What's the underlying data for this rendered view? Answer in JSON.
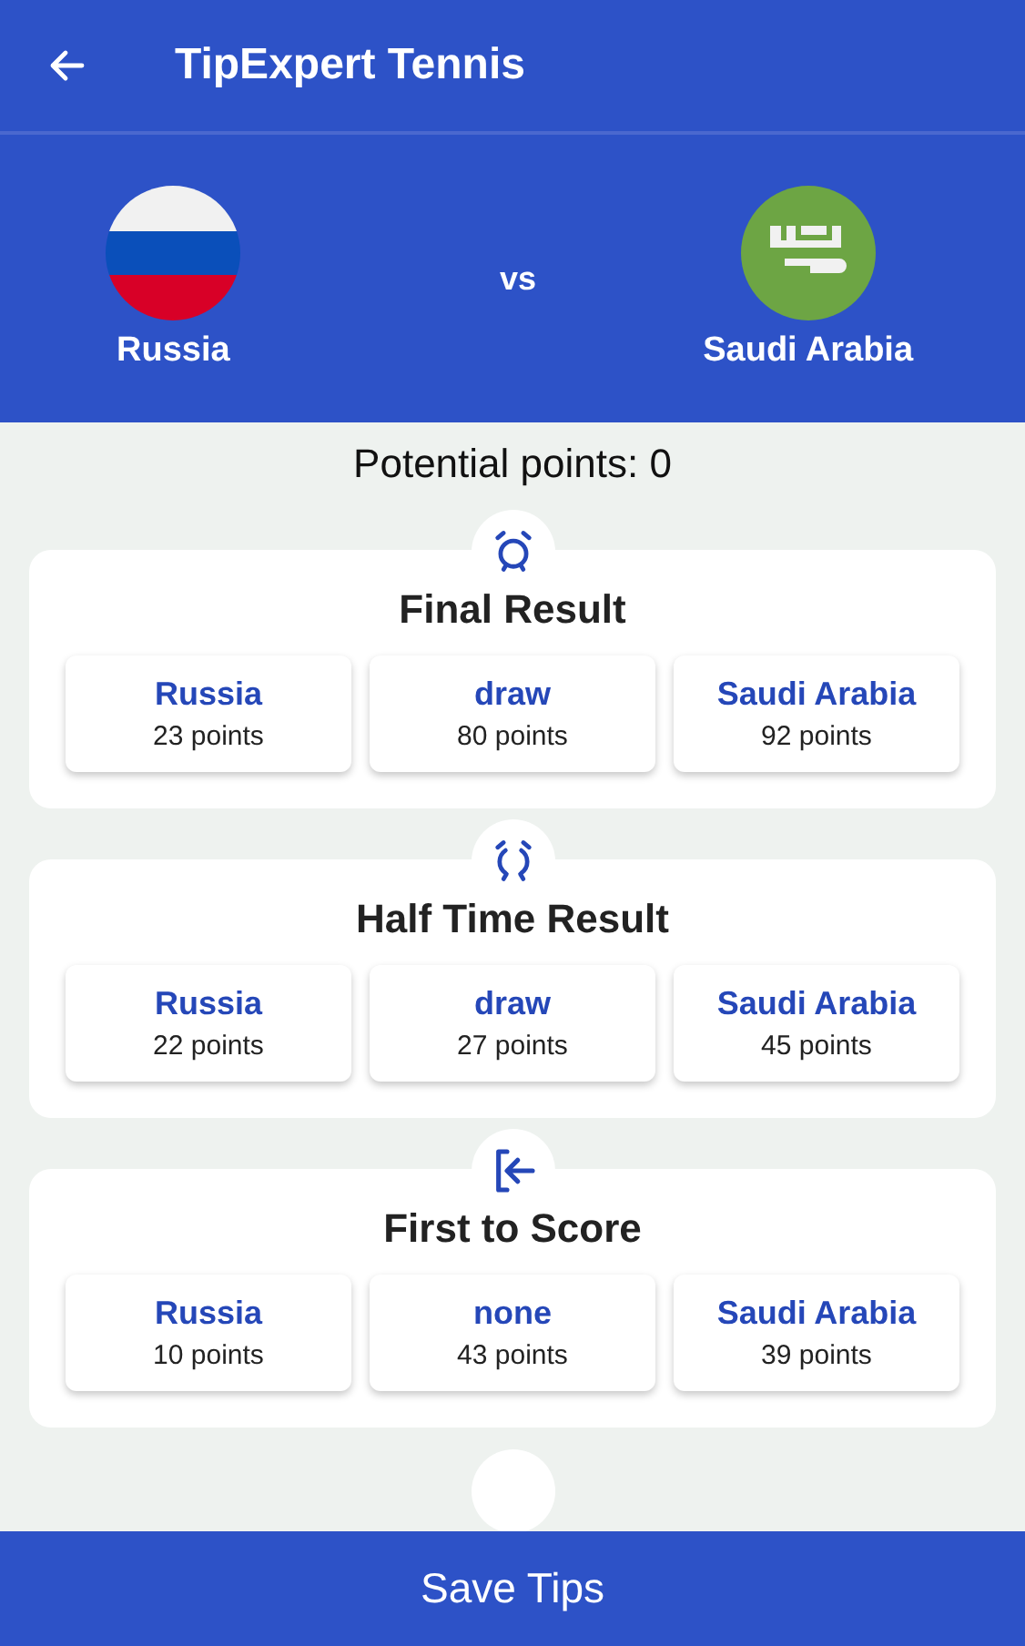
{
  "app_bar": {
    "title": "TipExpert Tennis"
  },
  "match": {
    "home": "Russia",
    "versus": "vs",
    "away": "Saudi Arabia"
  },
  "potential_points": "Potential points: 0",
  "bets": [
    {
      "title": "Final Result",
      "options": [
        {
          "label": "Russia",
          "points": "23 points"
        },
        {
          "label": "draw",
          "points": "80 points"
        },
        {
          "label": "Saudi Arabia",
          "points": "92 points"
        }
      ]
    },
    {
      "title": "Half Time Result",
      "options": [
        {
          "label": "Russia",
          "points": "22 points"
        },
        {
          "label": "draw",
          "points": "27 points"
        },
        {
          "label": "Saudi Arabia",
          "points": "45 points"
        }
      ]
    },
    {
      "title": "First to Score",
      "options": [
        {
          "label": "Russia",
          "points": "10 points"
        },
        {
          "label": "none",
          "points": "43 points"
        },
        {
          "label": "Saudi Arabia",
          "points": "39 points"
        }
      ]
    }
  ],
  "save_button": "Save Tips"
}
